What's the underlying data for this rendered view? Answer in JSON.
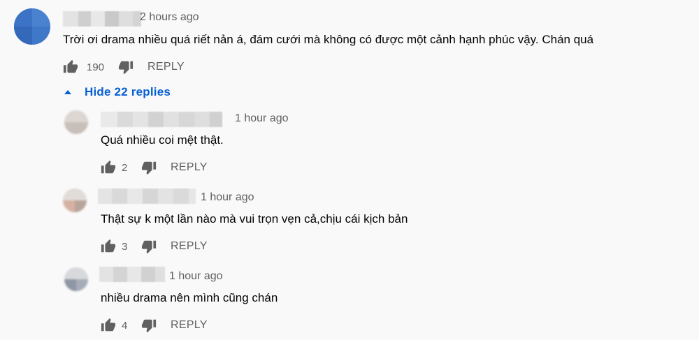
{
  "top_comment": {
    "timestamp": "2 hours ago",
    "text": "Trời ơi drama nhiều quá riết nản á, đám cưới mà không có được một cảnh hạnh phúc vậy. Chán quá",
    "likes": "190",
    "reply_label": "REPLY"
  },
  "toggle_replies": {
    "label": "Hide 22 replies",
    "icon": "caret-up-icon"
  },
  "replies": [
    {
      "timestamp": "1 hour ago",
      "text": "Quá nhiều coi mệt thật.",
      "likes": "2",
      "reply_label": "REPLY"
    },
    {
      "timestamp": "1 hour ago",
      "text": "Thật sự k một lần nào mà vui trọn vẹn cả,chịu cái kịch bản",
      "likes": "3",
      "reply_label": "REPLY"
    },
    {
      "timestamp": "1 hour ago",
      "text": "nhiều drama nên mình cũng chán",
      "likes": "4",
      "reply_label": "REPLY"
    }
  ],
  "icons": {
    "like": "thumbs-up-icon",
    "dislike": "thumbs-down-icon"
  },
  "colors": {
    "background": "#f9f9f9",
    "link_blue": "#065fd4",
    "secondary_text": "#606060",
    "icon_gray": "#606060"
  }
}
